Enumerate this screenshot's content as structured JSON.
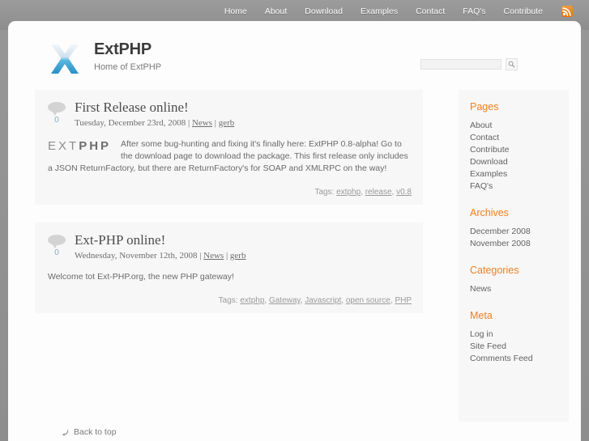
{
  "topnav": {
    "items": [
      {
        "label": "Home"
      },
      {
        "label": "About"
      },
      {
        "label": "Download"
      },
      {
        "label": "Examples"
      },
      {
        "label": "Contact"
      },
      {
        "label": "FAQ's"
      },
      {
        "label": "Contribute"
      }
    ],
    "rss_icon": "rss-icon"
  },
  "header": {
    "logo_icon": "x-logo-icon",
    "title": "ExtPHP",
    "description": "Home of ExtPHP"
  },
  "search": {
    "value": "",
    "placeholder": "",
    "button_icon": "search-icon"
  },
  "posts": [
    {
      "comment_count": "0",
      "comment_icon": "comment-bubble-icon",
      "title": "First Release online!",
      "date": "Tuesday, December 23rd, 2008",
      "sep": " | ",
      "category": "News",
      "author": "gerb",
      "inline_logo_light": "EXT",
      "inline_logo_bold": "PHP",
      "body": "After some bug-hunting and fixing it's finally here: ExtPHP 0.8-alpha! Go to the download page to download the package. This first release only includes a JSON ReturnFactory, but there are ReturnFactory's for SOAP and XMLRPC on the way!",
      "tags_label": "Tags: ",
      "tags": [
        "extphp",
        "release",
        "v0.8"
      ]
    },
    {
      "comment_count": "0",
      "comment_icon": "comment-bubble-icon",
      "title": "Ext-PHP online!",
      "date": "Wednesday, November 12th, 2008",
      "sep": " | ",
      "category": "News",
      "author": "gerb",
      "body": "Welcome tot Ext-PHP.org, the new PHP gateway!",
      "tags_label": "Tags: ",
      "tags": [
        "extphp",
        "Gateway",
        "Javascript",
        "open source",
        "PHP"
      ]
    }
  ],
  "back_to_top": {
    "label": "Back to top",
    "icon": "back-to-top-arrow-icon"
  },
  "sidebar": {
    "sections": [
      {
        "title": "Pages",
        "items": [
          "About",
          "Contact",
          "Contribute",
          "Download",
          "Examples",
          "FAQ's"
        ]
      },
      {
        "title": "Archives",
        "items": [
          "December 2008",
          "November 2008"
        ]
      },
      {
        "title": "Categories",
        "items": [
          "News"
        ]
      },
      {
        "title": "Meta",
        "items": [
          "Log in",
          "Site Feed",
          "Comments Feed"
        ]
      }
    ]
  },
  "colors": {
    "accent": "#ef8022",
    "page_bg": "#9a9a9a",
    "panel": "#f7f7f7",
    "card": "#fdfdfd",
    "link": "#636363"
  }
}
